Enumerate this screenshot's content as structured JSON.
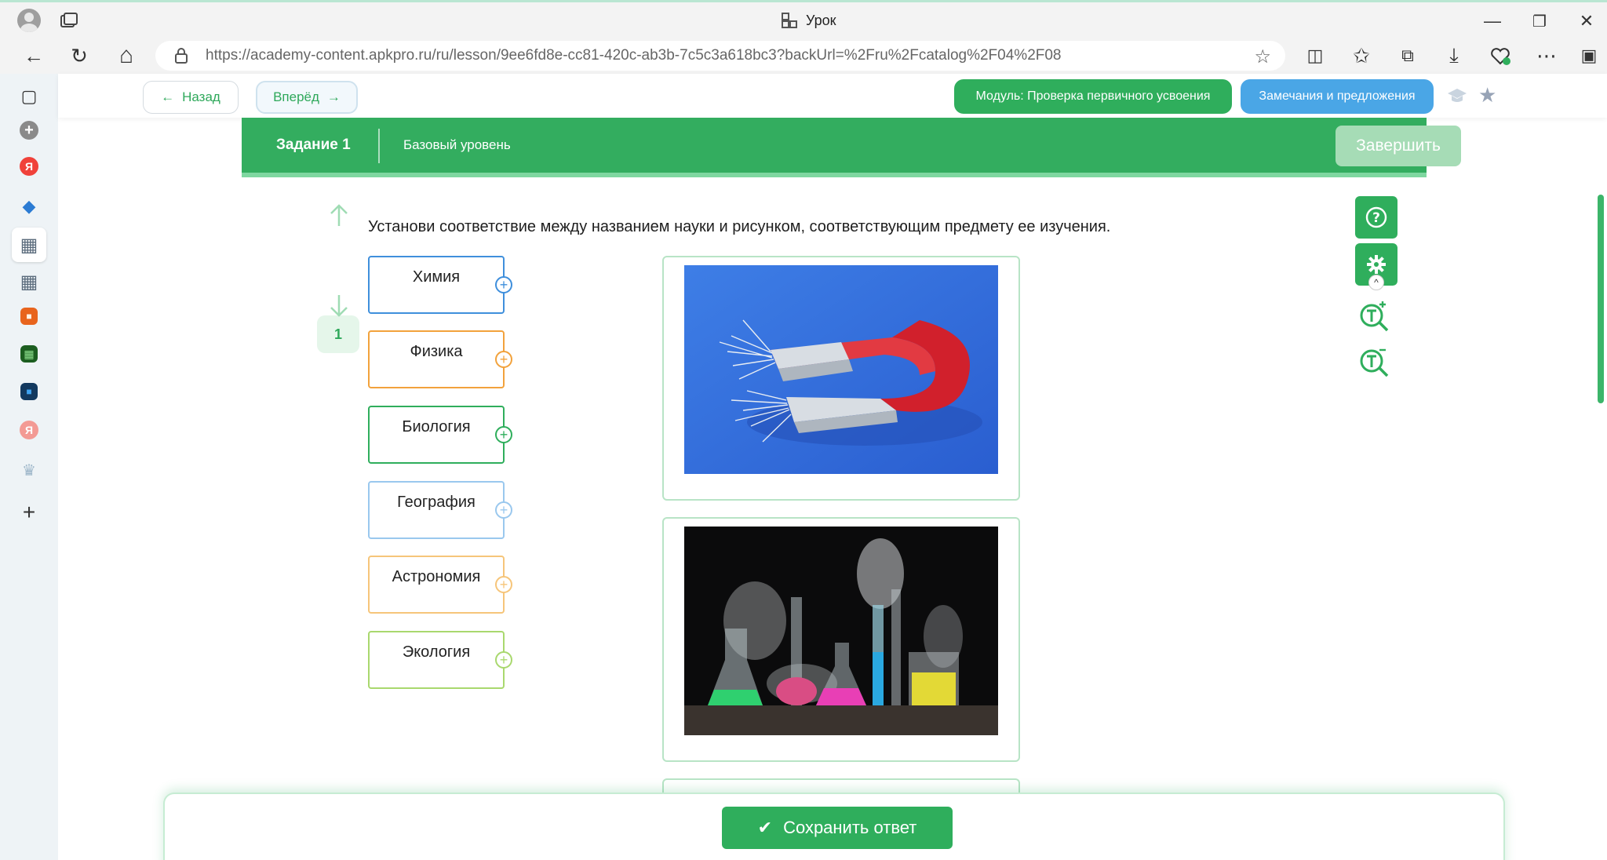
{
  "window": {
    "title": "Урок",
    "controls": {
      "minimize": "—",
      "maximize": "❐",
      "close": "✕"
    }
  },
  "addressbar": {
    "url": "https://academy-content.apkpro.ru/ru/lesson/9ee6fd8e-cc81-420c-ab3b-7c5c3a618bc3?backUrl=%2Fru%2Fcatalog%2F04%2F08"
  },
  "icons": {
    "back": "←",
    "reload": "↻",
    "home": "⌂",
    "star": "☆",
    "split": "◫",
    "favorites": "✩",
    "collections": "⧉",
    "download": "⤓",
    "more": "⋯",
    "sidebar": "▣",
    "add": "+"
  },
  "sidebar": {
    "items": [
      {
        "name": "tabs",
        "glyph": "▢",
        "color": "#333333"
      },
      {
        "name": "add-app",
        "glyph": "+",
        "color": "#8a8a8a"
      },
      {
        "name": "yandex",
        "glyph": "Я",
        "color": "#f0413a"
      },
      {
        "name": "store",
        "glyph": "◆",
        "color": "#2b7bd3"
      },
      {
        "name": "lesson-active",
        "glyph": "▦",
        "color": "#5a6b7c"
      },
      {
        "name": "lesson",
        "glyph": "▦",
        "color": "#5a6b7c"
      },
      {
        "name": "orange-app",
        "glyph": "■",
        "color": "#e8641d"
      },
      {
        "name": "green-app",
        "glyph": "▦",
        "color": "#2d7d32"
      },
      {
        "name": "blue-app",
        "glyph": "■",
        "color": "#1f6fb0"
      },
      {
        "name": "yandex-light",
        "glyph": "Я",
        "color": "#f39a94"
      },
      {
        "name": "emblem",
        "glyph": "♛",
        "color": "#9db6c9"
      }
    ]
  },
  "topnav": {
    "back_label": "Назад",
    "forward_label": "Вперёд",
    "back_arrow": "←",
    "forward_arrow": "→",
    "module_label": "Модуль: Проверка первичного усвоения",
    "remarks_label": "Замечания и предложения",
    "bookmark_star": "★"
  },
  "task": {
    "title": "Задание 1",
    "level": "Базовый уровень",
    "finish_label": "Завершить",
    "question_number": "1",
    "question": "Установи соответствие между названием науки и рисунком, соответствующим предмету ее изучения.",
    "terms": [
      {
        "label": "Химия",
        "color": "#3f8fdc"
      },
      {
        "label": "Физика",
        "color": "#f2a23c"
      },
      {
        "label": "Биология",
        "color": "#2fae5c"
      },
      {
        "label": "География",
        "color": "#9ac8ee"
      },
      {
        "label": "Астрономия",
        "color": "#f6c57a"
      },
      {
        "label": "Экология",
        "color": "#a9d86e"
      }
    ],
    "plus_glyph": "+",
    "save_label": "Сохранить ответ",
    "save_check": "✔"
  },
  "tools": {
    "help_glyph": "?",
    "toggle_glyph": "^"
  },
  "colors": {
    "accent_green": "#2fae5c",
    "accent_blue": "#4aa6e6"
  }
}
